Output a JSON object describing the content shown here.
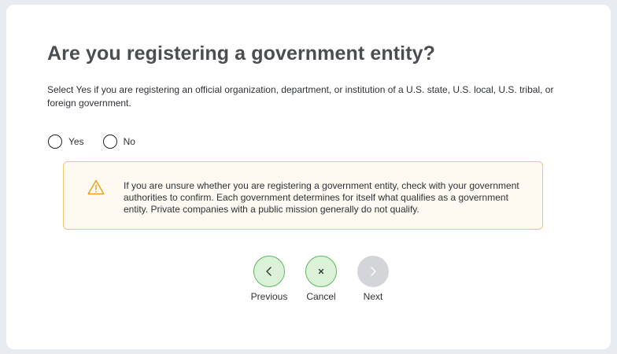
{
  "page": {
    "title": "Are you registering a government entity?",
    "description": "Select Yes if you are registering an official organization, department, or institution of a U.S. state, U.S. local, U.S. tribal, or foreign government."
  },
  "radio": {
    "options": [
      {
        "label": "Yes",
        "selected": false
      },
      {
        "label": "No",
        "selected": false
      }
    ]
  },
  "alert": {
    "icon": "warning-icon",
    "text": "If you are unsure whether you are registering a government entity, check with your government authorities to confirm. Each government determines for itself what qualifies as a government entity. Private companies with a public mission generally do not qualify.",
    "border_color": "#f0c873",
    "background_color": "#fefaf1"
  },
  "nav": {
    "previous": {
      "label": "Previous",
      "icon": "chevron-left-icon",
      "enabled": true
    },
    "cancel": {
      "label": "Cancel",
      "icon": "close-icon",
      "enabled": true
    },
    "next": {
      "label": "Next",
      "icon": "chevron-right-icon",
      "enabled": false
    },
    "active_color": "#5cb85c",
    "disabled_color": "#d4d5d8"
  }
}
